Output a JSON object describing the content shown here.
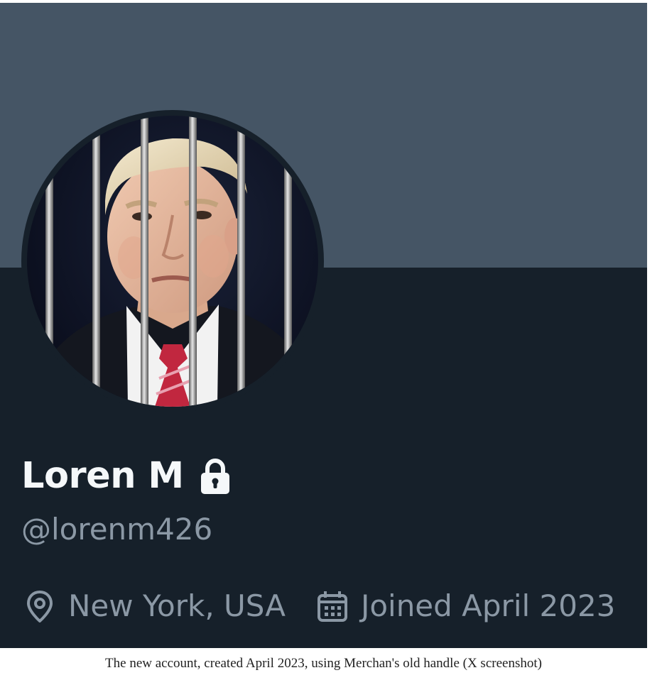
{
  "profile": {
    "display_name": "Loren M",
    "name_badge_icon": "lock-icon",
    "handle": "@lorenm426",
    "location": "New York, USA",
    "location_icon": "location-pin-icon",
    "joined": "Joined April 2023",
    "joined_icon": "calendar-icon",
    "avatar": "photo of a man in a suit and red striped tie behind prison bars"
  },
  "caption": "The new account, created April 2023, using Merchan's old handle (X screenshot)",
  "colors": {
    "banner": "#455565",
    "background": "#16202a",
    "name_text": "#f5f8fa",
    "secondary_text": "#8b98a5"
  }
}
